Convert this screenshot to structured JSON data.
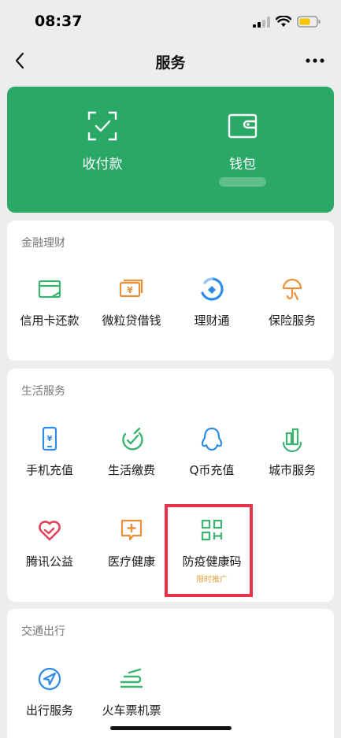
{
  "status": {
    "time": "08:37"
  },
  "nav": {
    "title": "服务"
  },
  "pay_card": {
    "items": [
      {
        "label": "收付款"
      },
      {
        "label": "钱包"
      }
    ]
  },
  "finance": {
    "title": "金融理财",
    "items": [
      {
        "label": "信用卡还款"
      },
      {
        "label": "微粒贷借钱"
      },
      {
        "label": "理财通"
      },
      {
        "label": "保险服务"
      }
    ]
  },
  "life": {
    "title": "生活服务",
    "items": [
      {
        "label": "手机充值"
      },
      {
        "label": "生活缴费"
      },
      {
        "label": "Q币充值"
      },
      {
        "label": "城市服务"
      },
      {
        "label": "腾讯公益"
      },
      {
        "label": "医疗健康"
      },
      {
        "label": "防疫健康码",
        "tag": "限时推广"
      }
    ]
  },
  "transport": {
    "title": "交通出行",
    "items": [
      {
        "label": "出行服务"
      },
      {
        "label": "火车票机票"
      }
    ]
  },
  "colors": {
    "brand_green": "#2aa866",
    "icon_green": "#3cb371",
    "icon_orange": "#e8913a",
    "icon_blue": "#2f8be6",
    "icon_red": "#e0445a",
    "highlight_red": "#e8324a"
  }
}
